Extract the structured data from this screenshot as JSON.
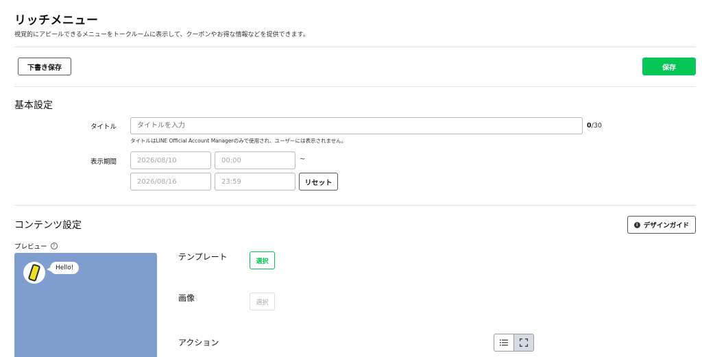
{
  "header": {
    "title": "リッチメニュー",
    "description": "視覚的にアピールできるメニューをトークルームに表示して、クーポンやお得な情報などを提供できます。"
  },
  "toolbar": {
    "draft_label": "下書き保存",
    "save_label": "保存"
  },
  "basic": {
    "section_title": "基本設定",
    "title_label": "タイトル",
    "title_placeholder": "タイトルを入力",
    "title_value": "",
    "counter_current": "0",
    "counter_max": "/30",
    "title_hint": "タイトルはLINE Official Account Managerのみで使用され、ユーザーには表示されません。",
    "period_label": "表示期間",
    "start_date": "2026/08/10",
    "start_time": "00:00",
    "tilde": "~",
    "end_date": "2026/08/16",
    "end_time": "23:59",
    "reset_label": "リセット"
  },
  "content": {
    "section_title": "コンテンツ設定",
    "design_guide_label": "デザインガイド",
    "preview_label": "プレビュー",
    "preview_bubble": "Hello!",
    "template_label": "テンプレート",
    "template_button": "選択",
    "image_label": "画像",
    "image_button": "選択",
    "action_label": "アクション"
  },
  "colors": {
    "accent": "#06c755",
    "preview_bg": "#7f9ed0"
  },
  "icons": {
    "help": "help-circle-icon",
    "info": "info-circle-icon",
    "list": "list-icon",
    "expand": "expand-icon"
  }
}
